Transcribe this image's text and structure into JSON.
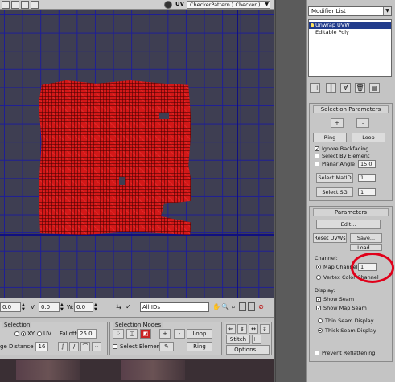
{
  "toolbar": {
    "uv_label": "UV",
    "texture": "CheckerPattern  ( Checker )"
  },
  "status": {
    "u_value": "0.0",
    "v_value": "0.0",
    "w_value": "0.0",
    "v_label": "V:",
    "w_label": "W:",
    "ids_value": "All IDs"
  },
  "bottom": {
    "selection_title": "Selection",
    "falloff_label": "Falloff:",
    "falloff_value": "25.0",
    "xy_label": "XY",
    "uv_label": "UV",
    "edge_distance_label": "ge Distance",
    "edge_distance_value": "16",
    "selection_modes_title": "Selection Modes",
    "select_element_label": "Select Element",
    "loop_label": "Loop",
    "ring_label": "Ring",
    "stitch_label": "Stitch",
    "options_label": "Options..."
  },
  "panel": {
    "modifier_list": "Modifier List",
    "stack": [
      {
        "label": "Unwrap UVW",
        "selected": true
      },
      {
        "label": "Editable Poly",
        "selected": false
      }
    ],
    "selection_parameters": {
      "title": "Selection Parameters",
      "plus": "+",
      "minus": "-",
      "ring": "Ring",
      "loop": "Loop",
      "ignore_backfacing": "Ignore Backfacing",
      "select_by_element": "Select By Element",
      "planar_angle": "Planar Angle",
      "planar_angle_value": "15.0",
      "select_matid": "Select MatID",
      "matid_value": "1",
      "select_sg": "Select SG",
      "sg_value": "1"
    },
    "parameters": {
      "title": "Parameters",
      "edit": "Edit...",
      "reset_uvws": "Reset UVWs",
      "save": "Save...",
      "load": "Load...",
      "channel_title": "Channel:",
      "map_channel": "Map Channel:",
      "map_channel_value": "1",
      "vertex_color_channel": "Vertex Color Channel",
      "display_title": "Display:",
      "show_seam": "Show Seam",
      "show_map_seam": "Show Map Seam",
      "thin_seam": "Thin Seam Display",
      "thick_seam": "Thick Seam Display",
      "prevent_reflattening": "Prevent Reflattening"
    }
  },
  "colors": {
    "viewport_bg": "#3e3e52",
    "grid_line": "#1e1e96",
    "uv_mesh": "#d41818",
    "annotation": "#e0001a",
    "selected_row": "#223c8c"
  }
}
